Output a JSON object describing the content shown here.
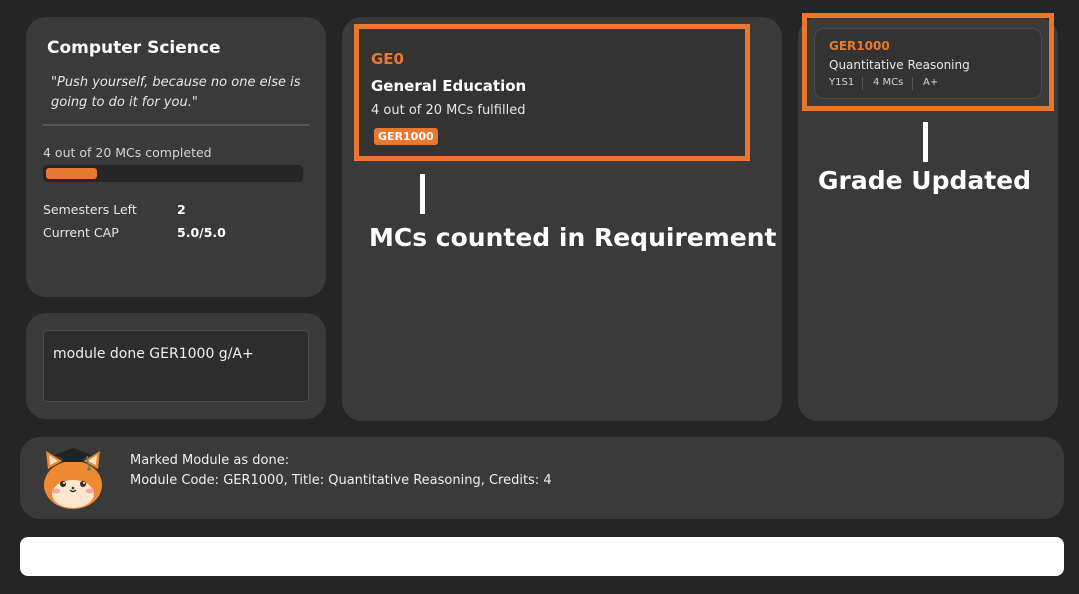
{
  "profile": {
    "major": "Computer Science",
    "quote": "\"Push yourself, because no one else is going to do it for you.\"",
    "progress_text": "4 out of 20 MCs completed",
    "progress_fraction": 0.2,
    "semesters_left_label": "Semesters Left",
    "semesters_left_value": "2",
    "cap_label": "Current CAP",
    "cap_value": "5.0/5.0"
  },
  "command_echo": "module done GER1000 g/A+",
  "requirement": {
    "code": "GE0",
    "name": "General Education",
    "progress": "4 out of 20 MCs fulfilled",
    "tags": [
      "GER1000"
    ]
  },
  "module": {
    "code": "GER1000",
    "title": "Quantitative Reasoning",
    "semester": "Y1S1",
    "credits": "4 MCs",
    "grade": "A+"
  },
  "annotations": {
    "requirement": "MCs counted in Requirement",
    "grade": "Grade Updated"
  },
  "result": {
    "line1": "Marked Module as done:",
    "line2": "Module Code: GER1000, Title: Quantitative Reasoning, Credits: 4"
  },
  "command_input": {
    "value": "",
    "placeholder": ""
  },
  "colors": {
    "accent": "#e8782f",
    "background": "#252525",
    "panel": "#3a3a3a"
  },
  "icons": {
    "mascot": "cat-graduation-cap-mascot"
  }
}
